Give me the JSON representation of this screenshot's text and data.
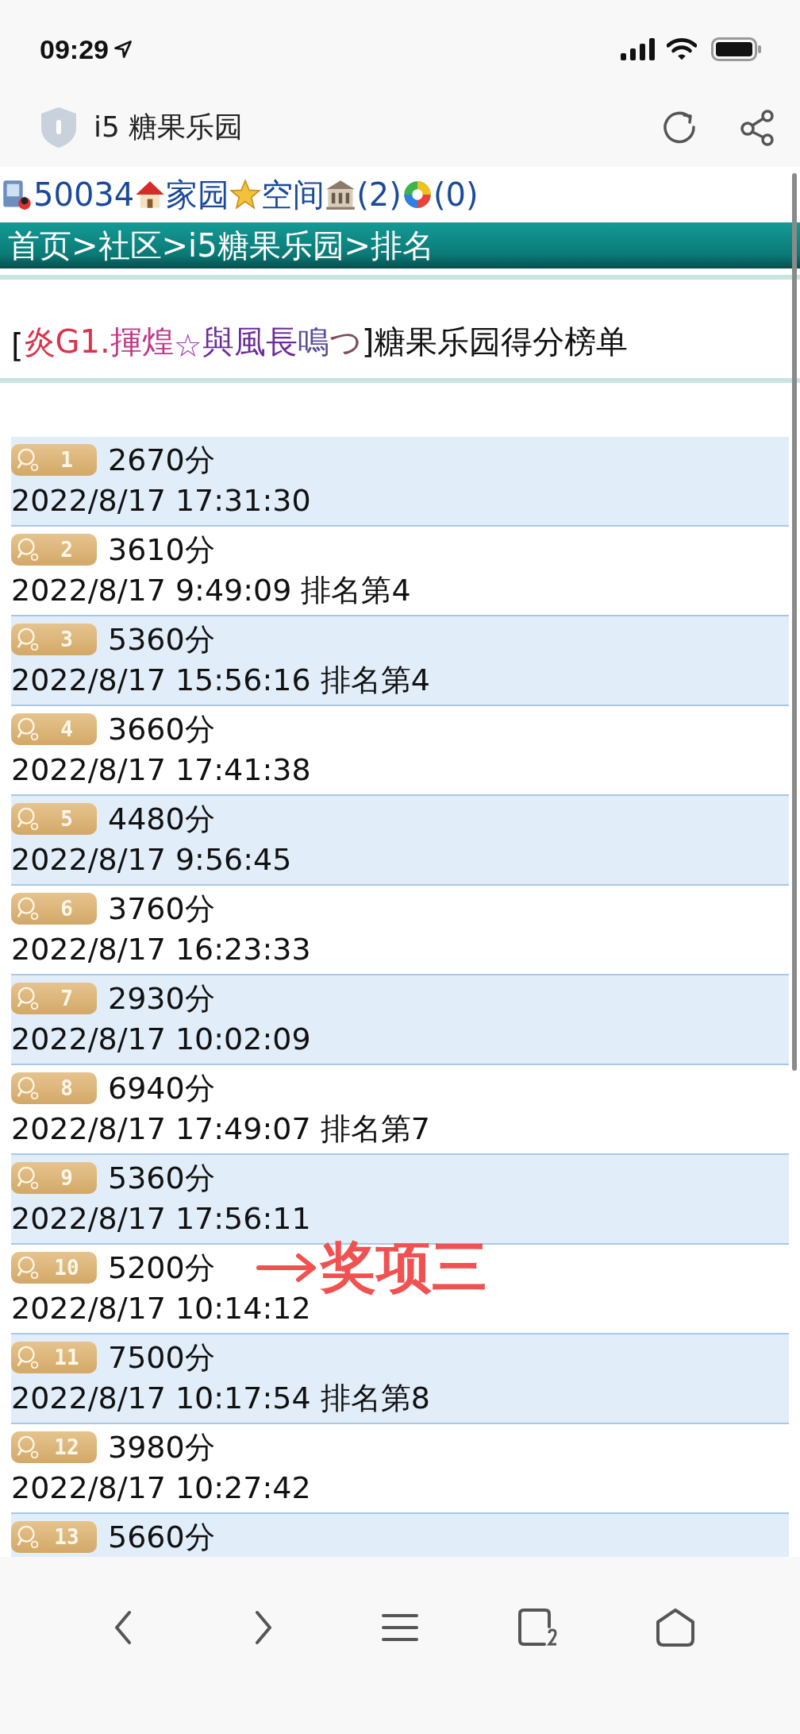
{
  "status_bar": {
    "time": "09:29"
  },
  "browser_bar": {
    "title": "i5 糖果乐园"
  },
  "user_links": [
    {
      "kind": "phone",
      "text": "50034"
    },
    {
      "kind": "house",
      "text": "家园"
    },
    {
      "kind": "star",
      "text": "空间"
    },
    {
      "kind": "building",
      "text": "(2)"
    },
    {
      "kind": "aperture",
      "text": "(0)"
    }
  ],
  "breadcrumb": "首页>社区>i5糖果乐园>排名",
  "heading": {
    "open": "[ ",
    "name_parts": [
      {
        "text": "炎G1.",
        "color": "#d9344f"
      },
      {
        "text": "揮煌",
        "color": "#c2378a"
      },
      {
        "text": "☆",
        "color": "#a23bb0"
      },
      {
        "text": "與風長",
        "color": "#6a2c9c"
      },
      {
        "text": "鳴",
        "color": "#5b4d9a"
      },
      {
        "text": "つ",
        "color": "#7d4a60"
      }
    ],
    "close": "]糖果乐园得分榜单"
  },
  "rows": [
    {
      "rank": "1",
      "score": "2670分",
      "detail": "2022/8/17 17:31:30"
    },
    {
      "rank": "2",
      "score": "3610分",
      "detail": "2022/8/17 9:49:09 排名第4"
    },
    {
      "rank": "3",
      "score": "5360分",
      "detail": "2022/8/17 15:56:16 排名第4"
    },
    {
      "rank": "4",
      "score": "3660分",
      "detail": "2022/8/17 17:41:38"
    },
    {
      "rank": "5",
      "score": "4480分",
      "detail": "2022/8/17 9:56:45"
    },
    {
      "rank": "6",
      "score": "3760分",
      "detail": "2022/8/17 16:23:33"
    },
    {
      "rank": "7",
      "score": "2930分",
      "detail": "2022/8/17 10:02:09"
    },
    {
      "rank": "8",
      "score": "6940分",
      "detail": "2022/8/17 17:49:07 排名第7"
    },
    {
      "rank": "9",
      "score": "5360分",
      "detail": "2022/8/17 17:56:11"
    },
    {
      "rank": "10",
      "score": "5200分",
      "detail": "2022/8/17 10:14:12",
      "annotation": "奖项三"
    },
    {
      "rank": "11",
      "score": "7500分",
      "detail": "2022/8/17 10:17:54 排名第8"
    },
    {
      "rank": "12",
      "score": "3980分",
      "detail": "2022/8/17 10:27:42"
    },
    {
      "rank": "13",
      "score": "5660分"
    }
  ]
}
